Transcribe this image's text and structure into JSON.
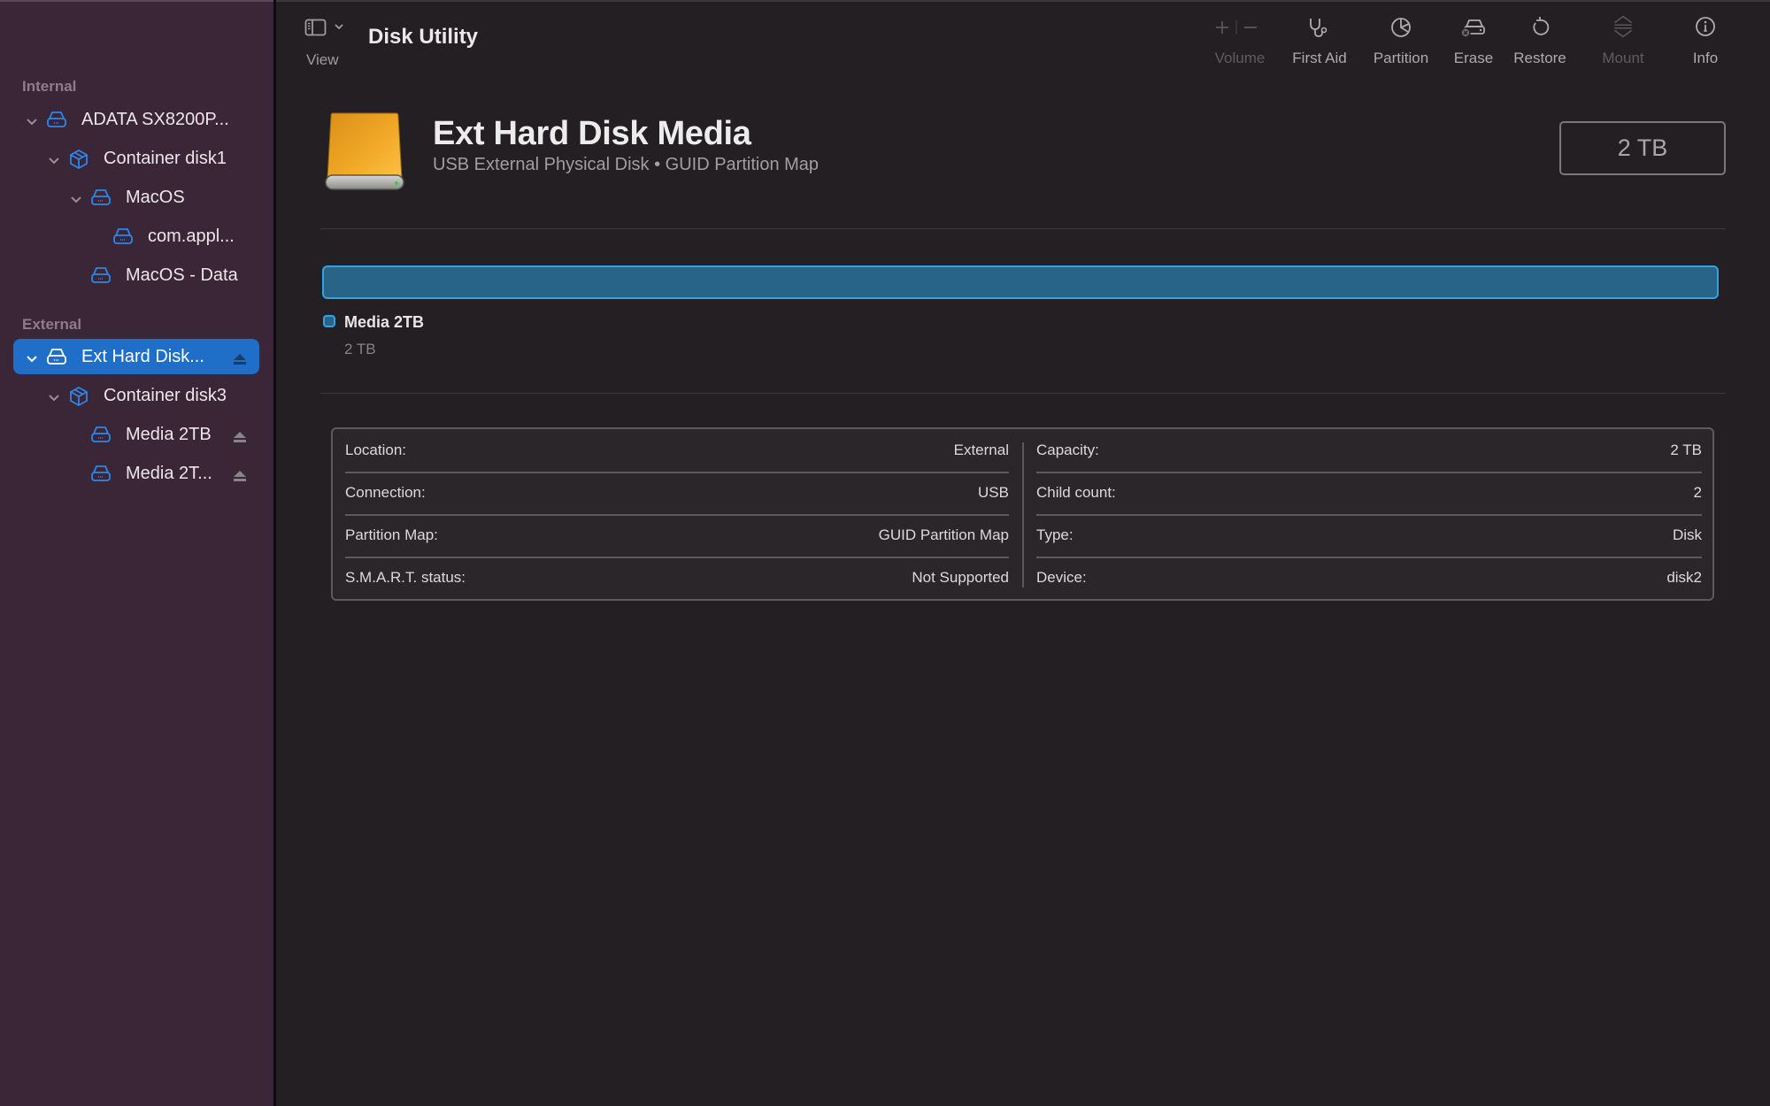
{
  "window": {
    "title": "Disk Utility"
  },
  "toolbar": {
    "view_label": "View",
    "buttons": [
      {
        "id": "volume",
        "label": "Volume",
        "icon": "plus-minus-icon",
        "enabled": false
      },
      {
        "id": "first-aid",
        "label": "First Aid",
        "icon": "stethoscope-icon",
        "enabled": true
      },
      {
        "id": "partition",
        "label": "Partition",
        "icon": "pie-chart-icon",
        "enabled": true
      },
      {
        "id": "erase",
        "label": "Erase",
        "icon": "erase-disk-icon",
        "enabled": true
      },
      {
        "id": "restore",
        "label": "Restore",
        "icon": "restore-arrow-icon",
        "enabled": true
      },
      {
        "id": "mount",
        "label": "Mount",
        "icon": "mount-icon",
        "enabled": false
      },
      {
        "id": "info",
        "label": "Info",
        "icon": "info-icon",
        "enabled": true
      }
    ]
  },
  "sidebar": {
    "sections": [
      {
        "label": "Internal",
        "items": [
          {
            "label": "ADATA SX8200P...",
            "icon": "drive-icon",
            "level": 0,
            "expanded": true,
            "selected": false,
            "eject": false
          },
          {
            "label": "Container disk1",
            "icon": "container-icon",
            "level": 1,
            "expanded": true,
            "selected": false,
            "eject": false
          },
          {
            "label": "MacOS",
            "icon": "volume-icon",
            "level": 2,
            "expanded": true,
            "selected": false,
            "eject": false
          },
          {
            "label": "com.appl...",
            "icon": "volume-icon",
            "level": 3,
            "expanded": null,
            "selected": false,
            "eject": false
          },
          {
            "label": "MacOS - Data",
            "icon": "volume-icon",
            "level": 2,
            "expanded": null,
            "selected": false,
            "eject": false
          }
        ]
      },
      {
        "label": "External",
        "items": [
          {
            "label": "Ext Hard Disk...",
            "icon": "drive-icon",
            "level": 0,
            "expanded": true,
            "selected": true,
            "eject": true
          },
          {
            "label": "Container disk3",
            "icon": "container-icon",
            "level": 1,
            "expanded": true,
            "selected": false,
            "eject": false
          },
          {
            "label": "Media 2TB",
            "icon": "volume-icon",
            "level": 2,
            "expanded": null,
            "selected": false,
            "eject": true
          },
          {
            "label": "Media 2T...",
            "icon": "volume-icon",
            "level": 2,
            "expanded": null,
            "selected": false,
            "eject": true
          }
        ]
      }
    ]
  },
  "disk": {
    "name": "Ext Hard Disk Media",
    "subtitle": "USB External Physical Disk • GUID Partition Map",
    "size": "2 TB"
  },
  "partitions": [
    {
      "name": "Media 2TB",
      "size": "2 TB",
      "fraction": 1.0,
      "color": "#286488",
      "border": "#35a1e5"
    }
  ],
  "info": {
    "left": [
      {
        "key": "Location:",
        "value": "External"
      },
      {
        "key": "Connection:",
        "value": "USB"
      },
      {
        "key": "Partition Map:",
        "value": "GUID Partition Map"
      },
      {
        "key": "S.M.A.R.T. status:",
        "value": "Not Supported"
      }
    ],
    "right": [
      {
        "key": "Capacity:",
        "value": "2 TB"
      },
      {
        "key": "Child count:",
        "value": "2"
      },
      {
        "key": "Type:",
        "value": "Disk"
      },
      {
        "key": "Device:",
        "value": "disk2"
      }
    ]
  },
  "colors": {
    "accent": "#1f6ec8",
    "icon_blue": "#2f86e6",
    "sidebar_bg": "#3b2638",
    "main_bg": "#231f22"
  }
}
